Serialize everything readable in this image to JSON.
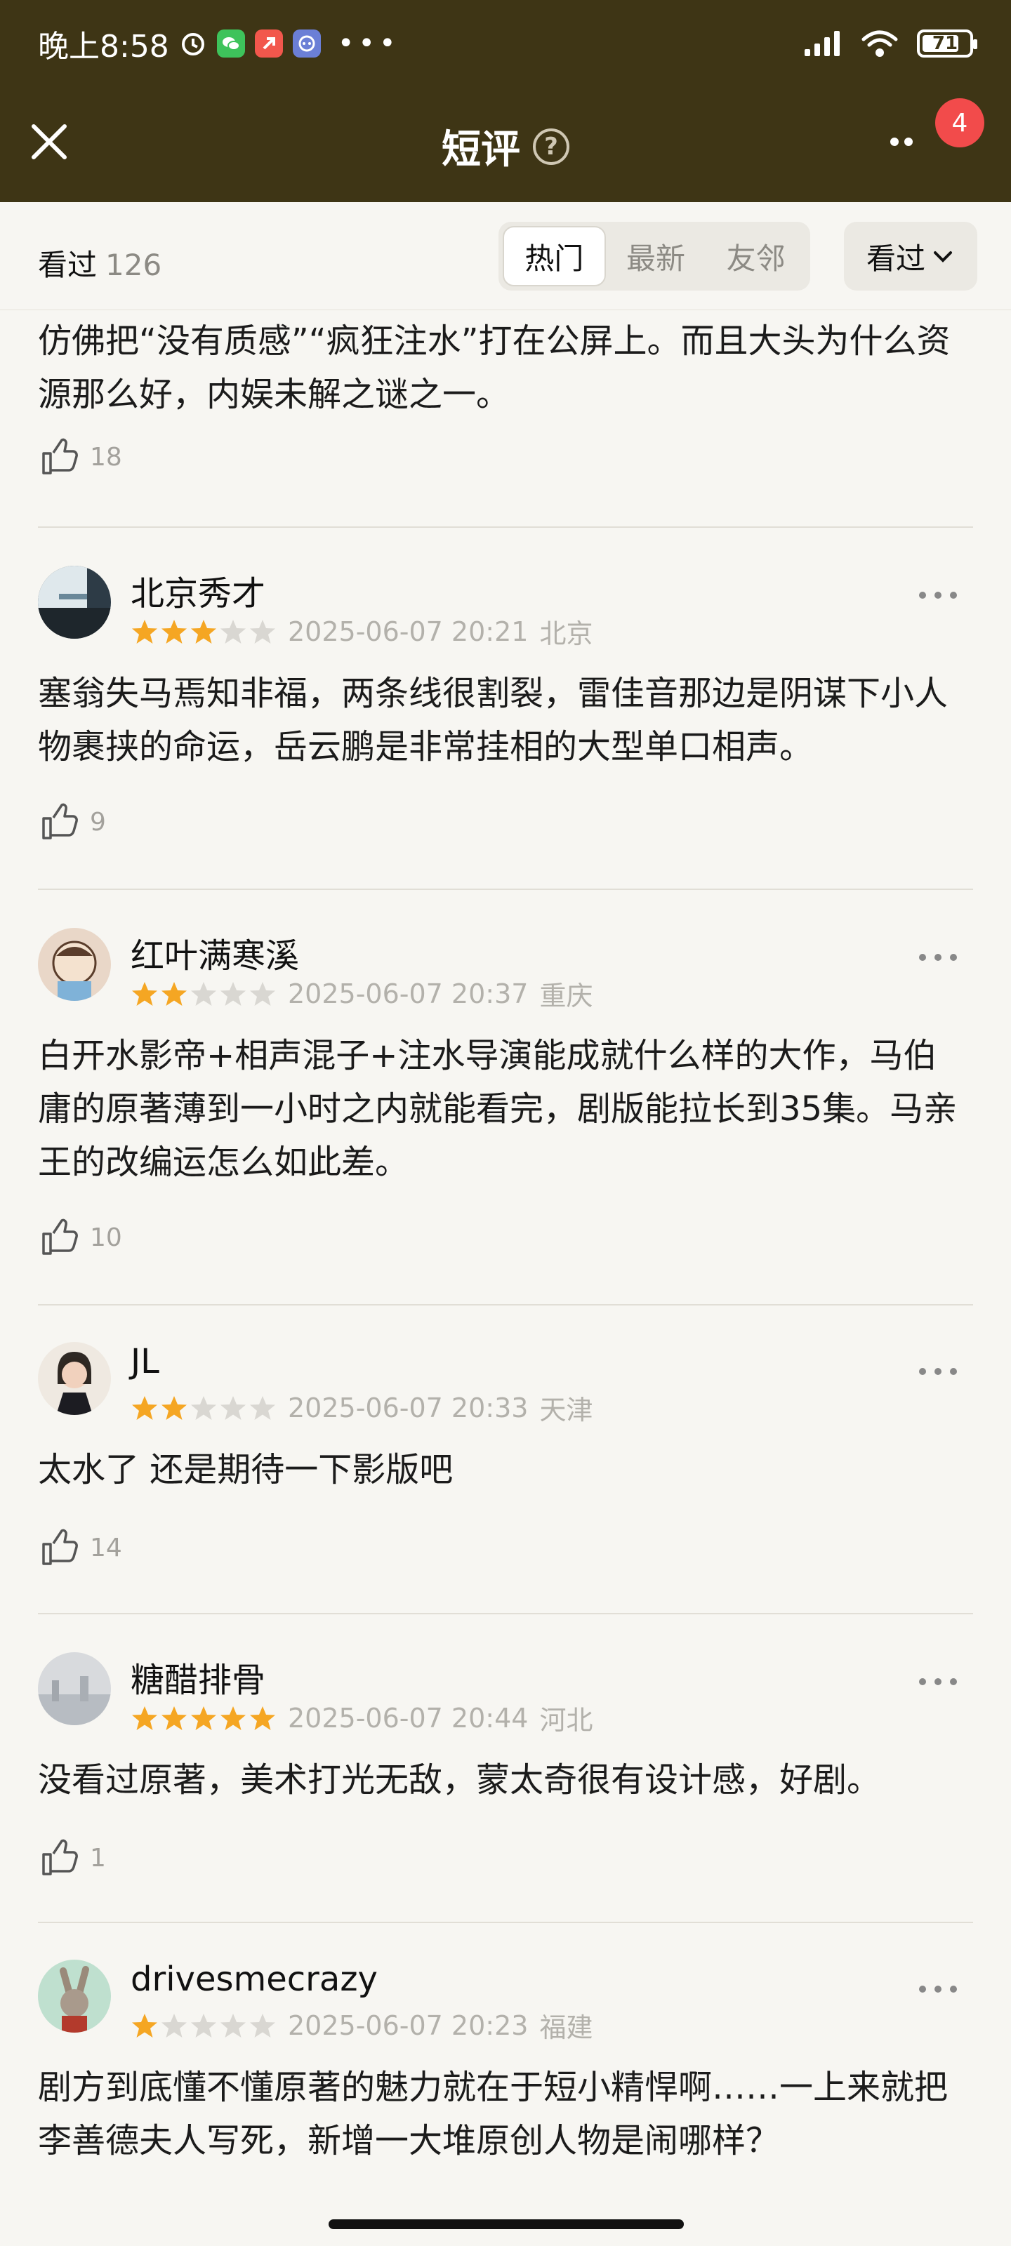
{
  "status_bar": {
    "time": "晚上8:58",
    "battery": "71",
    "battery_level_pct": 71
  },
  "header": {
    "title": "短评",
    "help": "?",
    "badge": "4"
  },
  "filter": {
    "seen_label": "看过",
    "seen_count": "126",
    "tabs": [
      "热门",
      "最新",
      "友邻"
    ],
    "active_tab": "热门",
    "dropdown": "看过"
  },
  "colors": {
    "header_bg": "#3e3515",
    "page_bg": "#f7f6f2",
    "star_on": "#f5a623",
    "star_off": "#d9d7d2",
    "badge": "#f24b4b"
  },
  "partial_comment": {
    "text": "仿佛把“没有质感”“疯狂注水”打在公屏上。而且大头为什么资源那么好，内娱未解之谜之一。",
    "likes": "18"
  },
  "comments": [
    {
      "name": "北京秀才",
      "rating": 3,
      "date": "2025-06-07 20:21",
      "location": "北京",
      "text": "塞翁失马焉知非福，两条线很割裂，雷佳音那边是阴谋下小人物裹挟的命运，岳云鹏是非常挂相的大型单口相声。",
      "likes": "9"
    },
    {
      "name": "红叶满寒溪",
      "rating": 2,
      "date": "2025-06-07 20:37",
      "location": "重庆",
      "text": "白开水影帝+相声混子+注水导演能成就什么样的大作，马伯庸的原著薄到一小时之内就能看完，剧版能拉长到35集。马亲王的改编运怎么如此差。",
      "likes": "10"
    },
    {
      "name": "JL",
      "rating": 2,
      "date": "2025-06-07 20:33",
      "location": "天津",
      "text": "太水了 还是期待一下影版吧",
      "likes": "14"
    },
    {
      "name": "糖醋排骨",
      "rating": 5,
      "date": "2025-06-07 20:44",
      "location": "河北",
      "text": "没看过原著，美术打光无敌，蒙太奇很有设计感，好剧。",
      "likes": "1"
    },
    {
      "name": "drivesmecrazy",
      "rating": 1,
      "date": "2025-06-07 20:23",
      "location": "福建",
      "text": "剧方到底懂不懂原著的魅力就在于短小精悍啊……一上来就把李善德夫人写死，新增一大堆原创人物是闹哪样？",
      "likes": ""
    }
  ]
}
